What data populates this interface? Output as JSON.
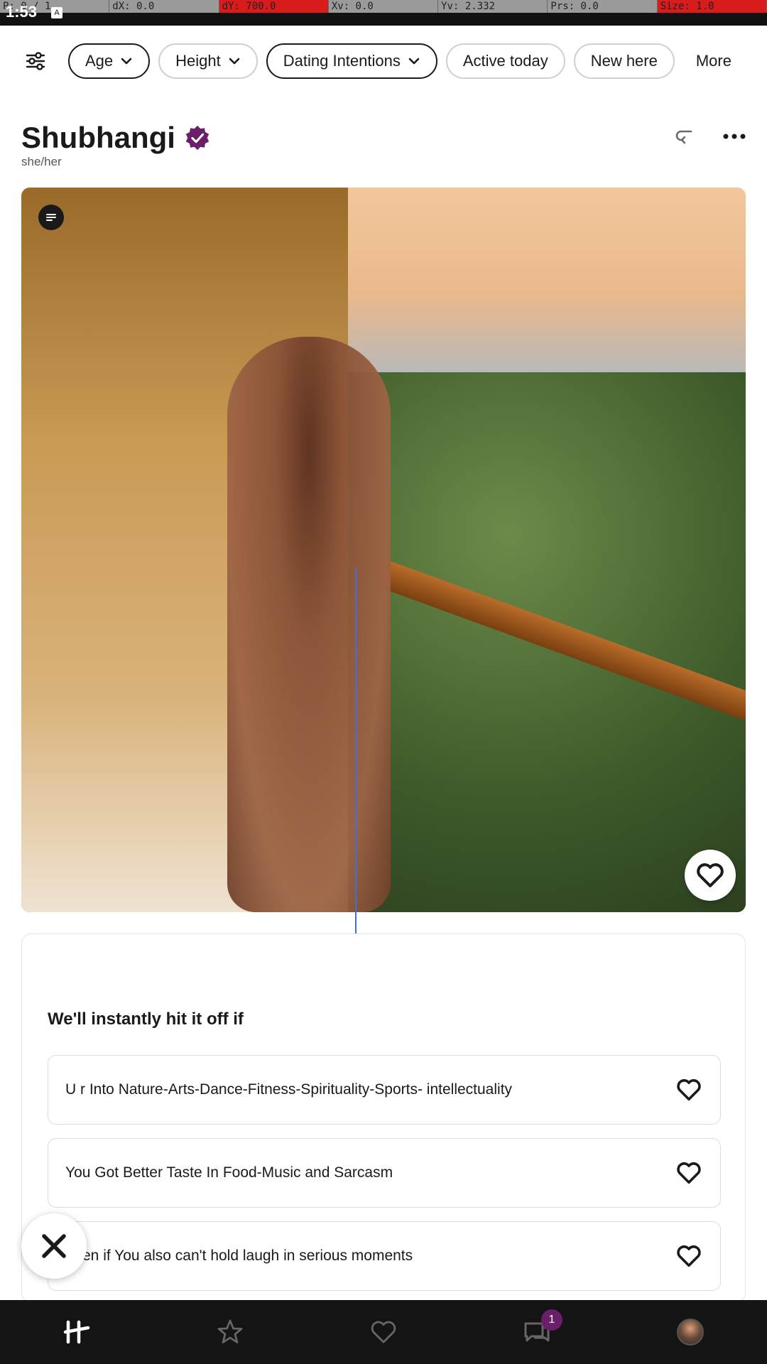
{
  "debug": {
    "p": "P: 0 / 1",
    "dx": "dX: 0.0",
    "dy": "dY: 700.0",
    "xv": "Xv: 0.0",
    "yv": "Yv: 2.332",
    "prs": "Prs: 0.0",
    "size": "Size: 1.0"
  },
  "status": {
    "time": "1:53",
    "notif_icon": "A"
  },
  "filters": {
    "chips": [
      {
        "label": "Age",
        "has_chevron": true,
        "active": true
      },
      {
        "label": "Height",
        "has_chevron": true,
        "active": false
      },
      {
        "label": "Dating Intentions",
        "has_chevron": true,
        "active": true
      },
      {
        "label": "Active today",
        "has_chevron": false,
        "active": false
      },
      {
        "label": "New here",
        "has_chevron": false,
        "active": false
      }
    ],
    "more_label": "More"
  },
  "profile": {
    "name": "Shubhangi",
    "pronouns": "she/her",
    "verified_color": "#6b1e6a"
  },
  "prompt": {
    "title": "We'll instantly hit it off if",
    "answers": [
      "U r Into Nature-Arts-Dance-Fitness-Spirituality-Sports- intellectuality",
      "You Got Better Taste In Food-Music and Sarcasm",
      "en if You also can't hold laugh in serious moments"
    ]
  },
  "nav": {
    "messages_badge": "1"
  },
  "colors": {
    "accent": "#6b1e6a",
    "nav_bg": "#141414"
  }
}
